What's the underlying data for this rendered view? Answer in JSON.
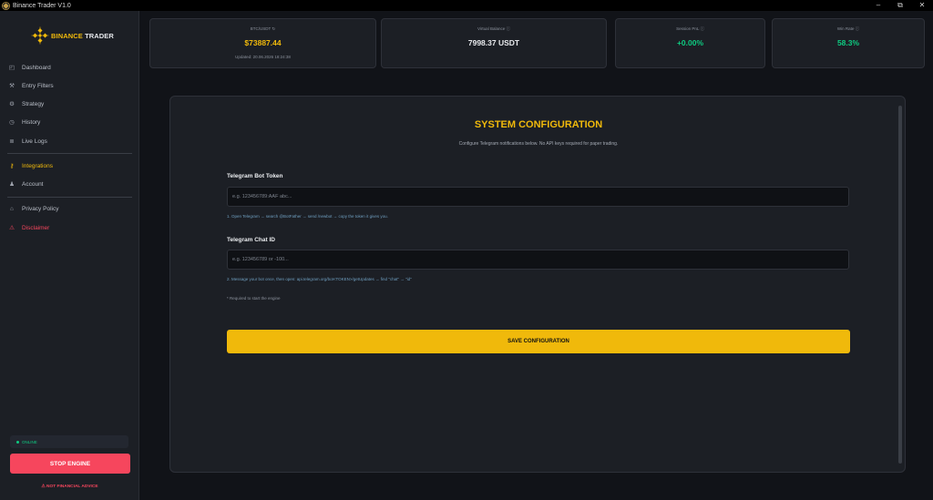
{
  "window": {
    "title": "Binance Trader V1.0",
    "minimize_glyph": "–",
    "maximize_glyph": "⧉",
    "close_glyph": "✕"
  },
  "brand": {
    "part1": "BINANCE",
    "part2": "TRADER",
    "accent": "#f0b90b"
  },
  "sidebar": {
    "items": [
      {
        "label": "Dashboard",
        "icon": "chart-icon",
        "glyph": "◰"
      },
      {
        "label": "Entry Filters",
        "icon": "wrench-icon",
        "glyph": "⚒"
      },
      {
        "label": "Strategy",
        "icon": "gear-icon",
        "glyph": "⚙"
      },
      {
        "label": "History",
        "icon": "clock-icon",
        "glyph": "◷"
      },
      {
        "label": "Live Logs",
        "icon": "document-icon",
        "glyph": "≣"
      },
      {
        "label": "Integrations",
        "icon": "key-icon",
        "glyph": "⚷"
      },
      {
        "label": "Account",
        "icon": "user-icon",
        "glyph": "♟"
      },
      {
        "label": "Privacy Policy",
        "icon": "lock-icon",
        "glyph": "⌂"
      },
      {
        "label": "Disclaimer",
        "icon": "warning-icon",
        "glyph": "⚠"
      }
    ],
    "status": "ONLINE",
    "stop_label": "STOP ENGINE",
    "nfa": "⚠  NOT FINANCIAL ADVICE"
  },
  "stats": {
    "price": {
      "label": "BTC/USDT",
      "value": "$73887.44",
      "updated": "Updated: 20.06.2026 18:24:38"
    },
    "balance": {
      "label": "Virtual Balance",
      "value": "7998.37 USDT"
    },
    "pnl": {
      "label": "Session PnL",
      "value": "+0.00%"
    },
    "winrate": {
      "label": "Win Rate",
      "value": "58.3%"
    }
  },
  "config": {
    "title": "SYSTEM CONFIGURATION",
    "description": "Configure Telegram notifications below. No API keys required for paper trading.",
    "token_label": "Telegram Bot Token",
    "token_placeholder": "e.g. 123456789:AAF abc...",
    "token_help": "1. Open Telegram → search @BotFather → send /newbot → copy the token it gives you.",
    "chat_label": "Telegram Chat ID",
    "chat_placeholder": "e.g. 123456789 or -100...",
    "chat_help": "2. Message your bot once, then open: api.telegram.org/bot<TOKEN>/getUpdates → find \"chat\" → \"id\"",
    "required_note": "* Required to start the engine",
    "save_label": "SAVE CONFIGURATION"
  }
}
